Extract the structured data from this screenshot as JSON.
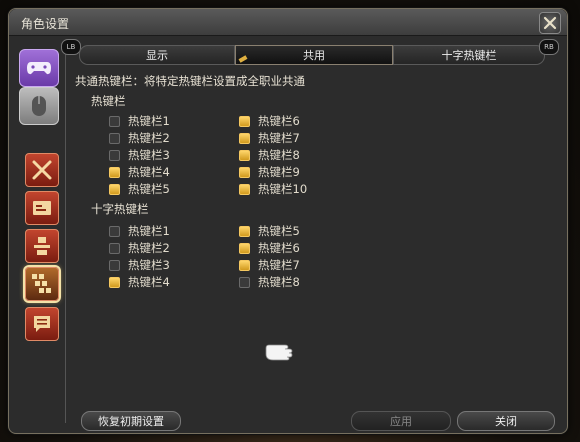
{
  "window": {
    "title": "角色设置"
  },
  "sidebar": {
    "devices": [
      {
        "name": "gamepad",
        "icon": "gamepad-icon"
      },
      {
        "name": "mouse",
        "icon": "mouse-icon"
      }
    ],
    "categories": [
      {
        "icon": "crossed-swords-icon",
        "selected": false
      },
      {
        "icon": "id-card-icon",
        "selected": false
      },
      {
        "icon": "character-icon",
        "selected": false
      },
      {
        "icon": "hotbar-icon",
        "selected": true
      },
      {
        "icon": "chat-icon",
        "selected": false
      }
    ]
  },
  "tabs": {
    "left_button": "LB",
    "right_button": "RB",
    "items": [
      "显示",
      "共用",
      "十字热键栏"
    ],
    "active": "共用"
  },
  "content": {
    "description": "共通热键栏：将特定热键栏设置成全职业共通",
    "hotbars": {
      "title": "热键栏",
      "items": [
        {
          "label": "热键栏1",
          "checked": false
        },
        {
          "label": "热键栏2",
          "checked": false
        },
        {
          "label": "热键栏3",
          "checked": false
        },
        {
          "label": "热键栏4",
          "checked": true
        },
        {
          "label": "热键栏5",
          "checked": true
        },
        {
          "label": "热键栏6",
          "checked": true
        },
        {
          "label": "热键栏7",
          "checked": true
        },
        {
          "label": "热键栏8",
          "checked": true
        },
        {
          "label": "热键栏9",
          "checked": true
        },
        {
          "label": "热键栏10",
          "checked": true
        }
      ]
    },
    "cross_hotbars": {
      "title": "十字热键栏",
      "items": [
        {
          "label": "热键栏1",
          "checked": false
        },
        {
          "label": "热键栏2",
          "checked": false
        },
        {
          "label": "热键栏3",
          "checked": false
        },
        {
          "label": "热键栏4",
          "checked": true
        },
        {
          "label": "热键栏5",
          "checked": true
        },
        {
          "label": "热键栏6",
          "checked": true
        },
        {
          "label": "热键栏7",
          "checked": true
        },
        {
          "label": "热键栏8",
          "checked": false
        }
      ]
    }
  },
  "buttons": {
    "reset": "恢复初期设置",
    "apply": "应用",
    "close": "关闭"
  },
  "colors": {
    "checked": "#f0b83a",
    "accent": "#8a5ed0"
  }
}
